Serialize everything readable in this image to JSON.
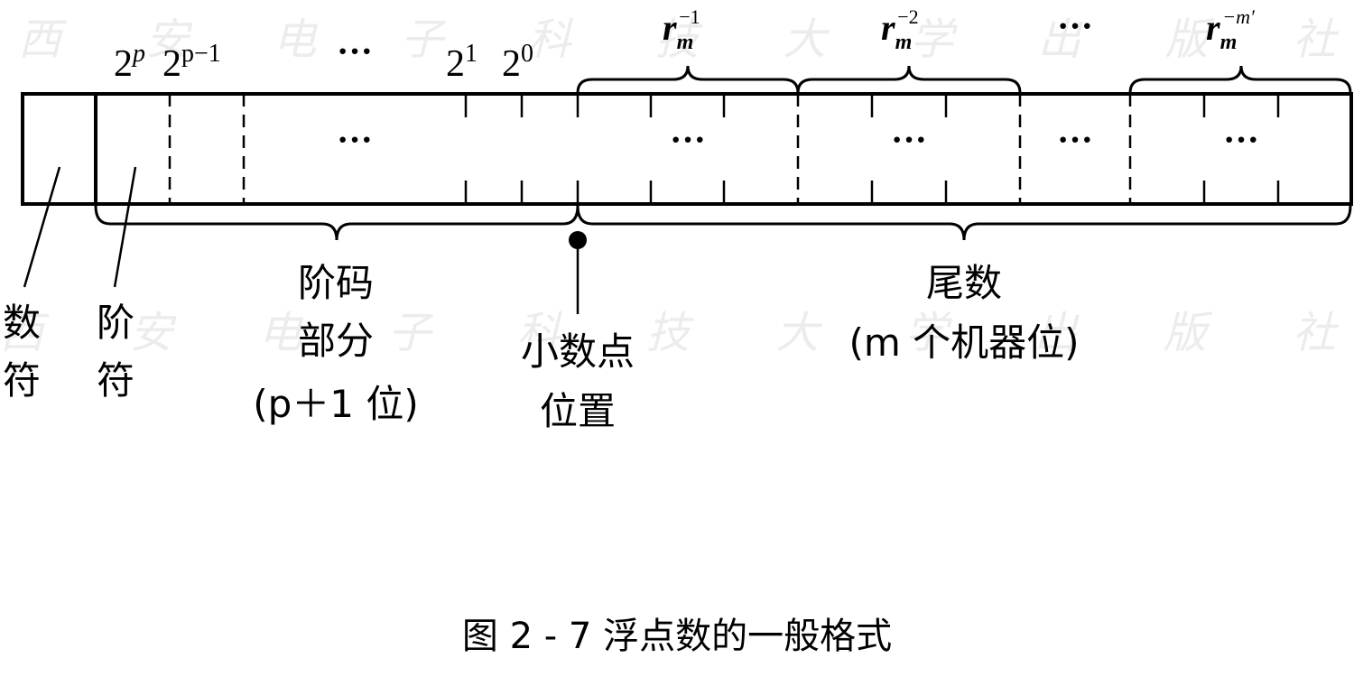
{
  "watermark": {
    "text_top": "西安电子科技大学出版社",
    "text_mid": "西安电子科技大学出版社"
  },
  "top_labels": {
    "two_p_base": "2",
    "two_p_exp": "p",
    "two_p1_base": "2",
    "two_p1_exp": "p−1",
    "dots_left": "···",
    "two_1_base": "2",
    "two_1_exp": "1",
    "two_0_base": "2",
    "two_0_exp": "0",
    "rm1_base": "r",
    "rm1_sub": "m",
    "rm1_sup": "−1",
    "rm2_base": "r",
    "rm2_sub": "m",
    "rm2_sup": "−2",
    "dots_right": "···",
    "rmm_base": "r",
    "rmm_sub": "m",
    "rmm_sup": "−m′"
  },
  "cell_dots": {
    "exponent": "···",
    "mantissa_group1": "···",
    "mantissa_group2": "···",
    "mantissa_gap": "···",
    "mantissa_group3": "···"
  },
  "bottom_labels": {
    "sign_line1": "数",
    "sign_line2": "符",
    "exp_sign_line1": "阶",
    "exp_sign_line2": "符",
    "exponent_line1": "阶码",
    "exponent_line2": "部分",
    "exponent_line3": "(p＋1 位)",
    "point_line1": "小数点",
    "point_line2": "位置",
    "mantissa_line1": "尾数",
    "mantissa_line2": "(m 个机器位)"
  },
  "caption": "图 2 - 7  浮点数的一般格式"
}
